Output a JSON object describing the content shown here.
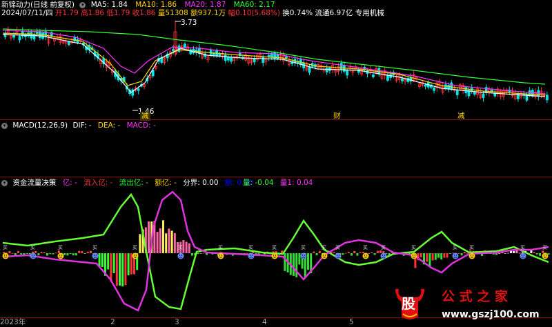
{
  "header": {
    "stock_name": "新锦动力",
    "adjust_mode": "(日线 前复权)",
    "ma": [
      {
        "label": "MA5: 1.84",
        "color": "#ffffff"
      },
      {
        "label": "MA10: 1.86",
        "color": "#ffd400"
      },
      {
        "label": "MA20: 1.87",
        "color": "#ff33ff"
      },
      {
        "label": "MA60: 2.17",
        "color": "#33ff33"
      }
    ]
  },
  "quote": {
    "date": "2024/07/11/四",
    "open": "开1.79",
    "high": "高1.86",
    "low": "低1.79",
    "close": "收1.86",
    "volume": "量51308",
    "amount": "额937.1万",
    "change": "幅0.10(5.68%)",
    "turnover": "换0.74%",
    "float_cap": "流通6.97亿",
    "industry": "专用机械"
  },
  "price_annotations": {
    "high_value": "3.73",
    "low_value": "1.46"
  },
  "markers": {
    "events": [
      "减",
      "财",
      "减"
    ]
  },
  "macd_panel": {
    "title": "MACD(12,26,9)",
    "dif": "DIF: -",
    "dea": "DEA: -",
    "macd": "MACD: -"
  },
  "flow_panel": {
    "title": "资金流量决策",
    "yi": "亿: -",
    "inflow": "流入亿: -",
    "outflow": "流出亿: -",
    "amount": "额亿: -",
    "boundary": "分界: 0.00",
    "hidden_val": "额: 0.00",
    "liang": "量: -0.04",
    "liang1": "量1: 0.04"
  },
  "time_axis": {
    "labels": [
      "2023年",
      "2",
      "3",
      "4",
      "5"
    ]
  },
  "watermark": {
    "logo_char": "股",
    "site_name": "公 式 之 家",
    "url": "www.gszj100.com"
  },
  "colors": {
    "up": "#ff3333",
    "down": "#00e5e5",
    "ma5": "#ffffff",
    "ma10": "#ffd400",
    "ma20": "#ff33ff",
    "ma60": "#33ff33",
    "panel_separator": "#8a1010",
    "flow_green_line": "#66ff33",
    "flow_magenta_line": "#e033e0"
  }
}
